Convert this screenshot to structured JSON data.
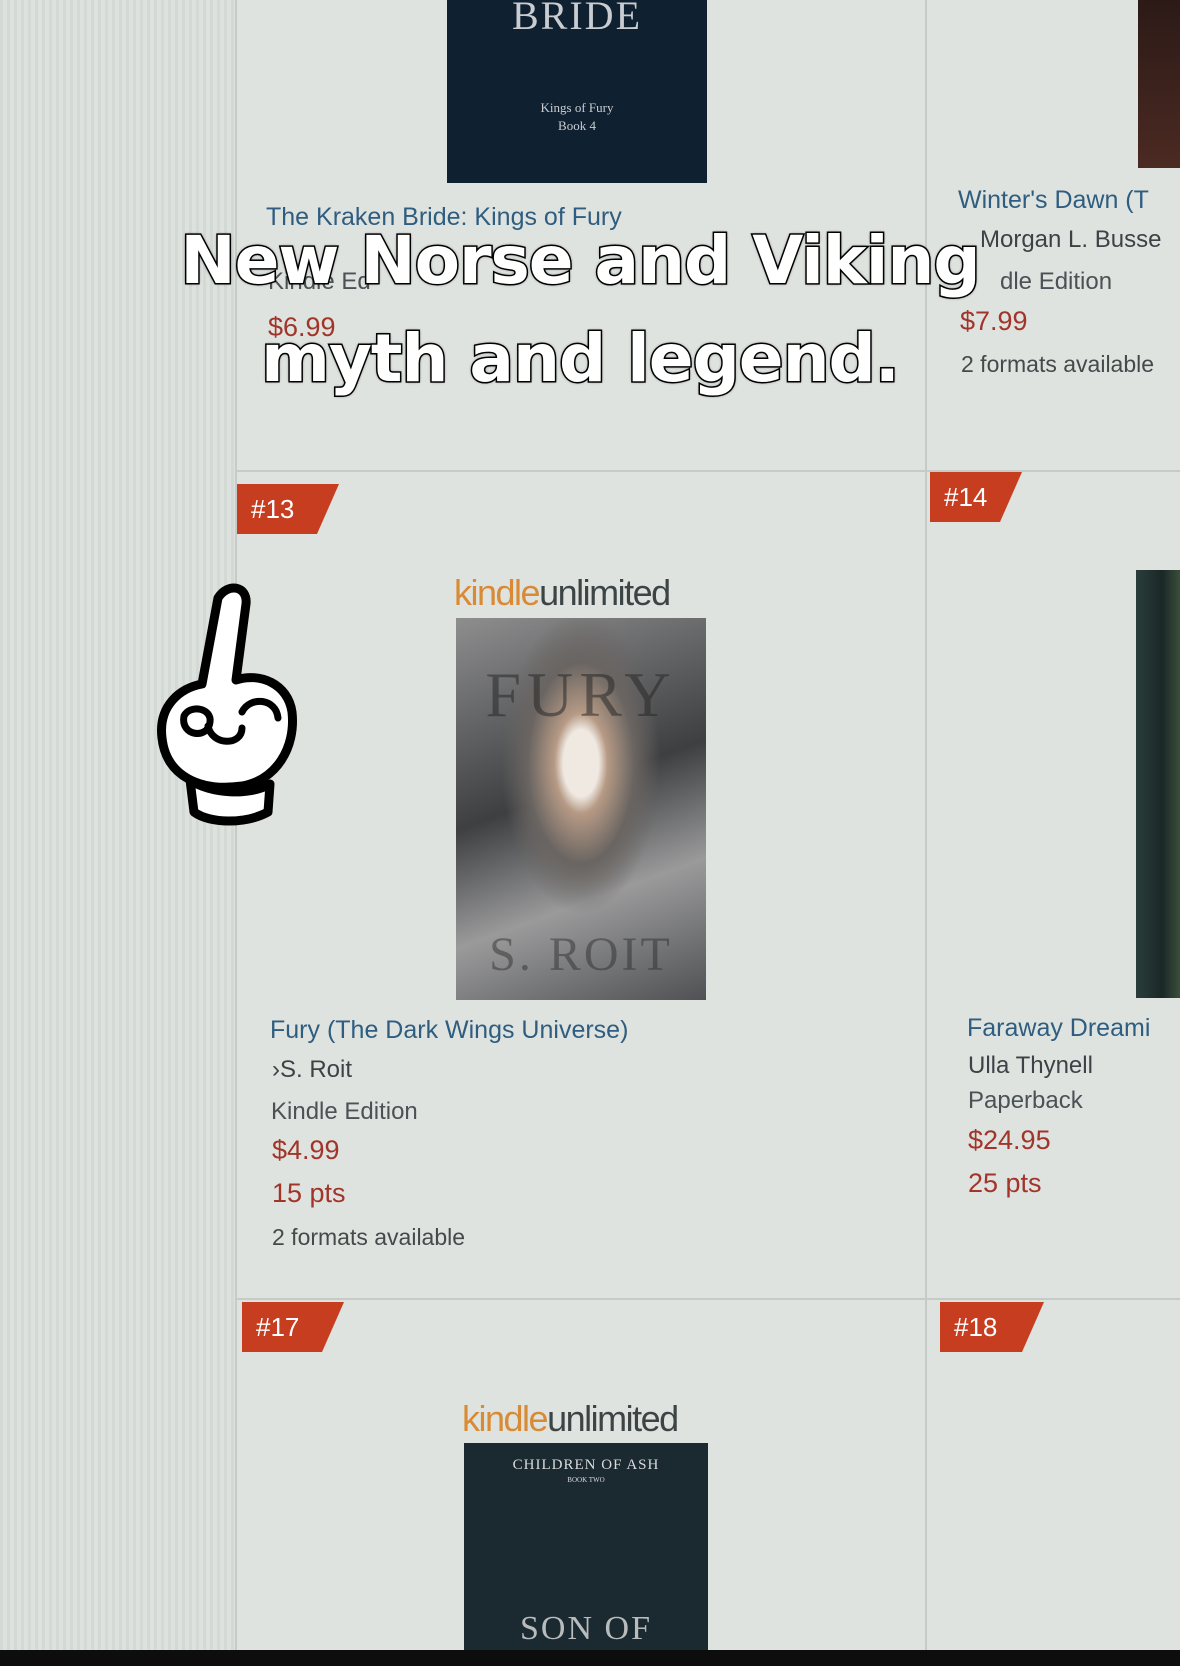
{
  "overlay": {
    "line1": "New Norse and Viking",
    "line2": "myth and legend."
  },
  "kindle_unlimited": {
    "kindle": "kindle",
    "unlimited": "unlimited"
  },
  "top_row": {
    "left": {
      "cover_title": "BRIDE",
      "cover_series": "Kings of Fury",
      "cover_book": "Book 4",
      "title": "The Kraken Bride: Kings of Fury",
      "format_partial": "Kindle Ed",
      "price": "$6.99"
    },
    "right": {
      "title": "Winter's Dawn (T",
      "author": "Morgan L. Busse",
      "format": "dle Edition",
      "price": "$7.99",
      "available": "2 formats available"
    }
  },
  "products": [
    {
      "rank": "#13",
      "cover_title": "FURY",
      "cover_author": "S. ROIT",
      "title": "Fury (The Dark Wings Universe)",
      "author": "›S. Roit",
      "format": "Kindle Edition",
      "price": "$4.99",
      "points": "15 pts",
      "available": "2 formats available"
    },
    {
      "rank": "#14",
      "title": "Faraway Dreami",
      "author": "Ulla Thynell",
      "format": "Paperback",
      "price": "$24.95",
      "points": "25 pts"
    },
    {
      "rank": "#17",
      "cover_title": "CHILDREN OF ASH",
      "cover_sub": "BOOK TWO",
      "cover_bottom": "SON OF"
    },
    {
      "rank": "#18"
    }
  ],
  "colors": {
    "rank_badge": "#c63d20",
    "title_link": "#2f5d80",
    "price": "#a1352a",
    "kindle_orange": "#d98a35"
  },
  "icons": [
    "pointing-hand-icon"
  ]
}
